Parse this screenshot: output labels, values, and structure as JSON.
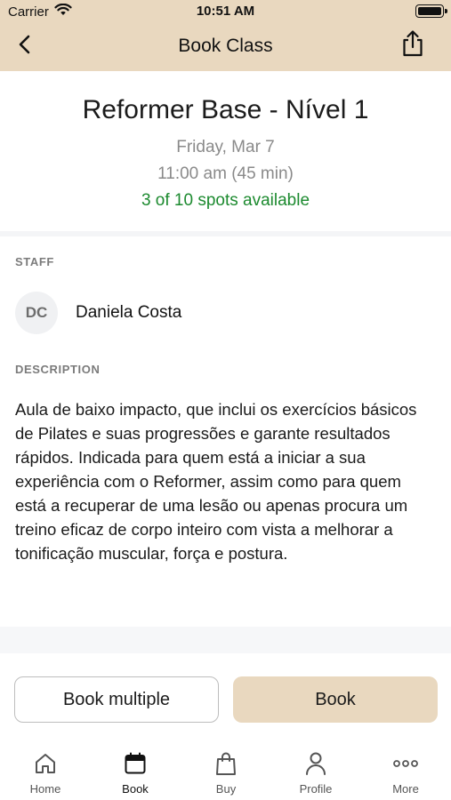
{
  "status_bar": {
    "carrier": "Carrier",
    "time": "10:51 AM",
    "icons": [
      "wifi-icon",
      "battery-icon"
    ]
  },
  "navbar": {
    "title": "Book Class",
    "back_icon": "chevron-left-icon",
    "share_icon": "share-icon"
  },
  "class_info": {
    "title": "Reformer Base - Nível 1",
    "date": "Friday, Mar 7",
    "time": "11:00 am (45 min)",
    "spots": "3 of 10 spots available"
  },
  "staff": {
    "label": "STAFF",
    "initials": "DC",
    "name": "Daniela Costa"
  },
  "description": {
    "label": "DESCRIPTION",
    "text": "Aula de baixo impacto, que inclui os exercícios básicos de Pilates e suas progressões e garante resultados rápidos. Indicada para quem está a iniciar a sua experiência com o Reformer, assim como para quem está a recuperar de uma lesão ou apenas procura um treino eficaz de corpo inteiro com vista a melhorar a tonificação muscular, força e postura."
  },
  "actions": {
    "book_multiple": "Book multiple",
    "book": "Book"
  },
  "tabbar": {
    "items": [
      {
        "label": "Home",
        "icon": "home-icon"
      },
      {
        "label": "Book",
        "icon": "calendar-icon",
        "active": true
      },
      {
        "label": "Buy",
        "icon": "shopping-bag-icon"
      },
      {
        "label": "Profile",
        "icon": "person-icon"
      },
      {
        "label": "More",
        "icon": "more-dots-icon"
      }
    ]
  },
  "colors": {
    "accent": "#e9d8bf",
    "spots_green": "#1c8a2f",
    "muted_text": "#8a8a8a"
  }
}
